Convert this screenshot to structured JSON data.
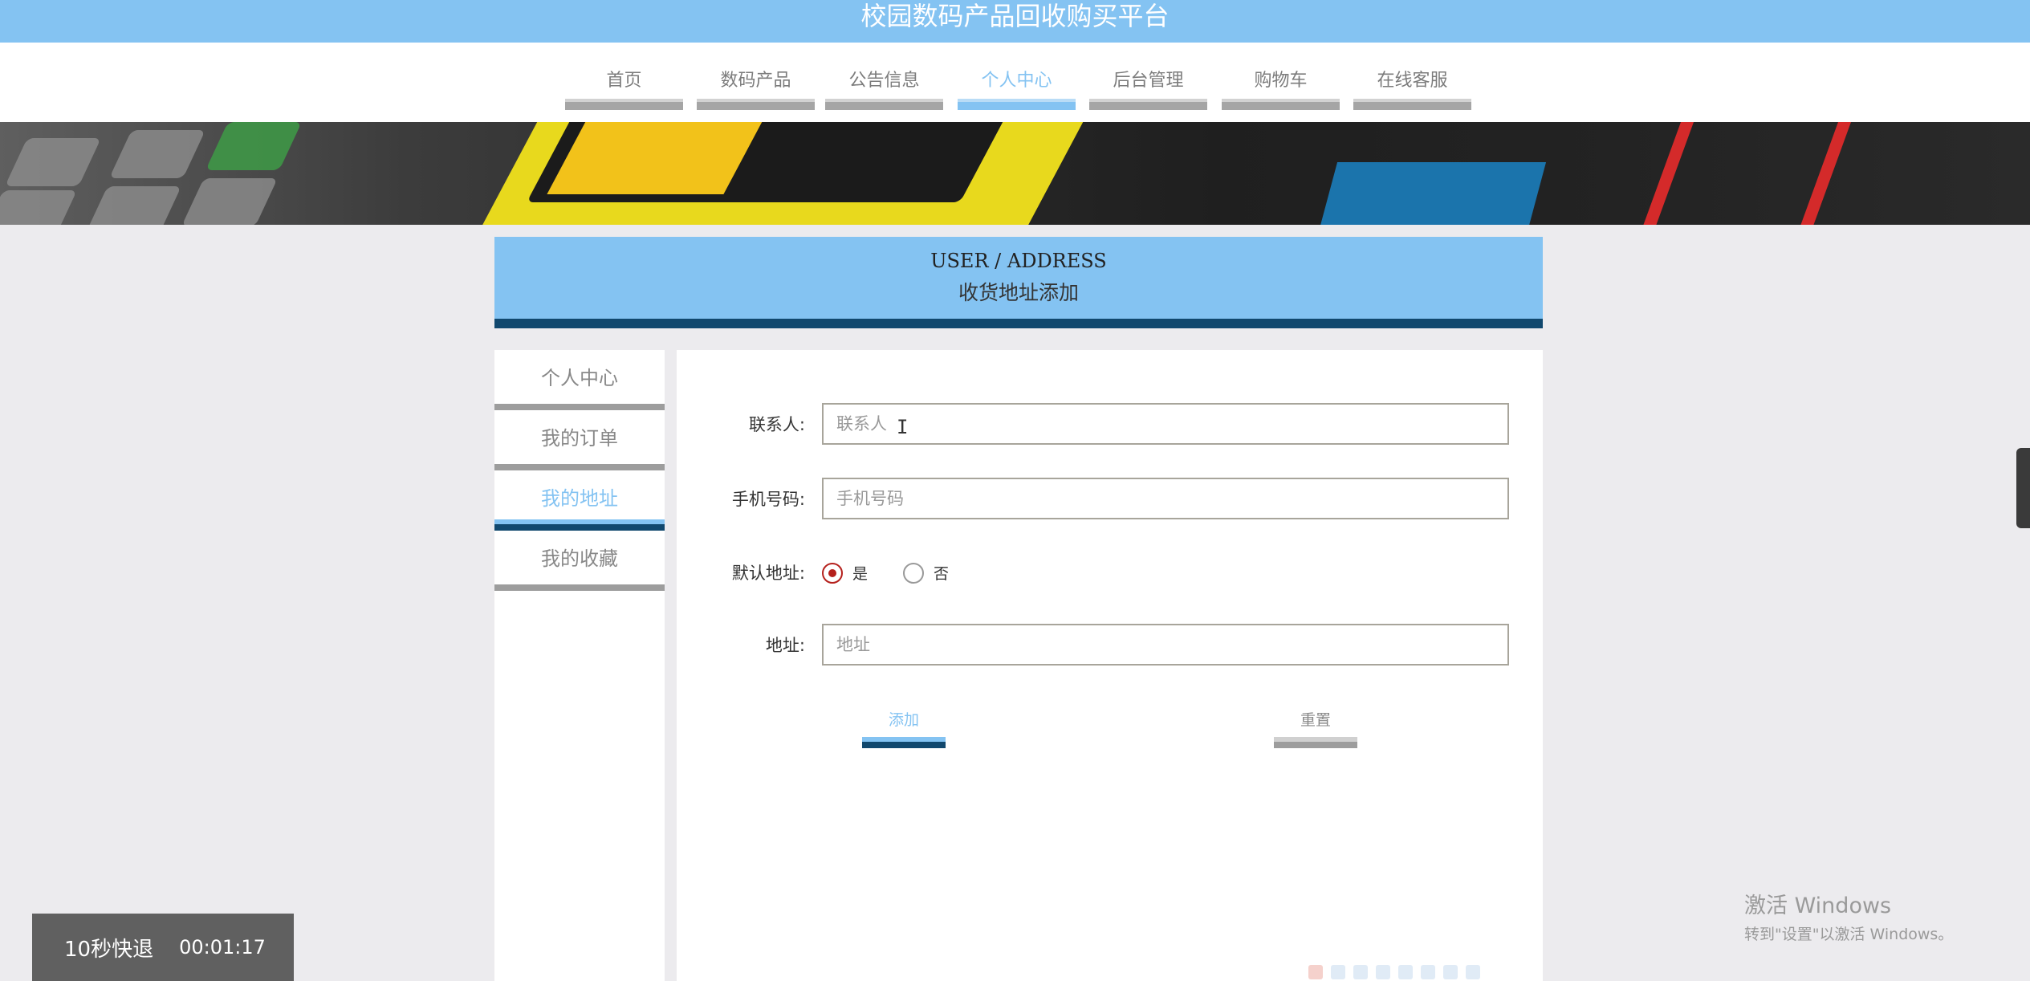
{
  "site": {
    "title": "校园数码产品回收购买平台"
  },
  "nav": {
    "items": [
      {
        "label": "首页"
      },
      {
        "label": "数码产品"
      },
      {
        "label": "公告信息"
      },
      {
        "label": "个人中心",
        "active": true
      },
      {
        "label": "后台管理"
      },
      {
        "label": "购物车"
      },
      {
        "label": "在线客服"
      }
    ]
  },
  "page_header": {
    "en": "USER / ADDRESS",
    "cn": "收货地址添加"
  },
  "sidebar": {
    "items": [
      {
        "label": "个人中心"
      },
      {
        "label": "我的订单"
      },
      {
        "label": "我的地址",
        "active": true
      },
      {
        "label": "我的收藏"
      }
    ]
  },
  "form": {
    "contact": {
      "label": "联系人:",
      "placeholder": "联系人",
      "value": ""
    },
    "phone": {
      "label": "手机号码:",
      "placeholder": "手机号码",
      "value": ""
    },
    "default_address": {
      "label": "默认地址:",
      "options": [
        "是",
        "否"
      ],
      "selected": "是"
    },
    "address": {
      "label": "地址:",
      "placeholder": "地址",
      "value": ""
    },
    "add_button": "添加",
    "reset_button": "重置"
  },
  "video": {
    "rewind_label": "10秒快退",
    "timestamp": "00:01:17"
  },
  "os_watermark": {
    "line1": "激活 Windows",
    "line2": "转到\"设置\"以激活 Windows。"
  },
  "colors": {
    "accent": "#84c3f2",
    "dark_strip": "#11486e",
    "radio_checked": "#b5201c"
  }
}
